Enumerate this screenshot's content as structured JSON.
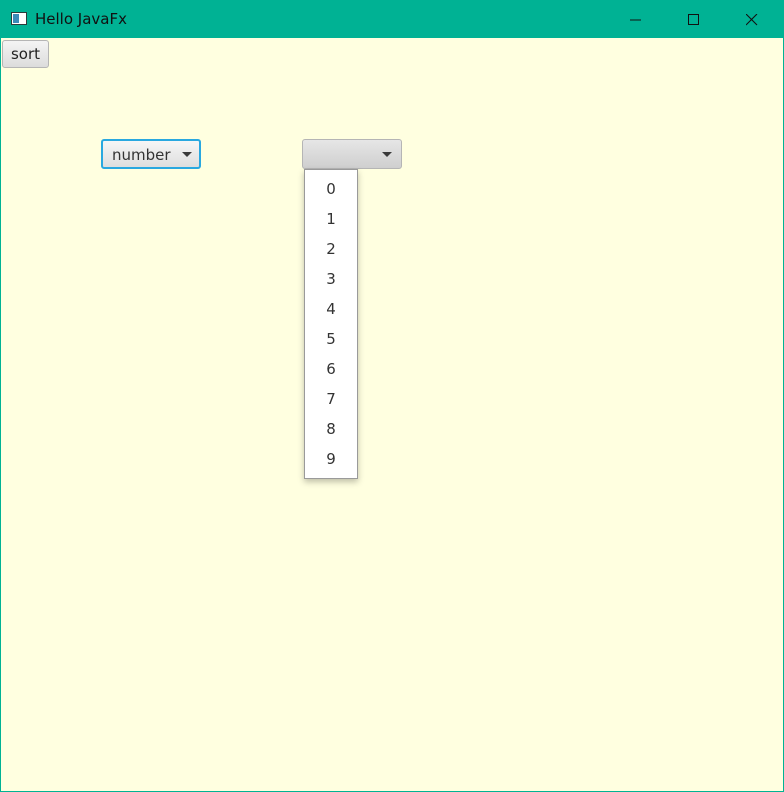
{
  "window": {
    "title": "Hello JavaFx",
    "titlebar_color": "#00b294",
    "background_color": "#ffffe0",
    "controls": {
      "minimize_icon": "minimize-icon",
      "maximize_icon": "maximize-icon",
      "close_icon": "close-icon"
    }
  },
  "toolbar": {
    "sort_label": "sort"
  },
  "combo_boxes": [
    {
      "value": "number",
      "focused": true
    },
    {
      "value": "",
      "open": true
    }
  ],
  "dropdown": {
    "options": [
      "0",
      "1",
      "2",
      "3",
      "4",
      "5",
      "6",
      "7",
      "8",
      "9"
    ]
  },
  "accent_color": "#29a8e0"
}
